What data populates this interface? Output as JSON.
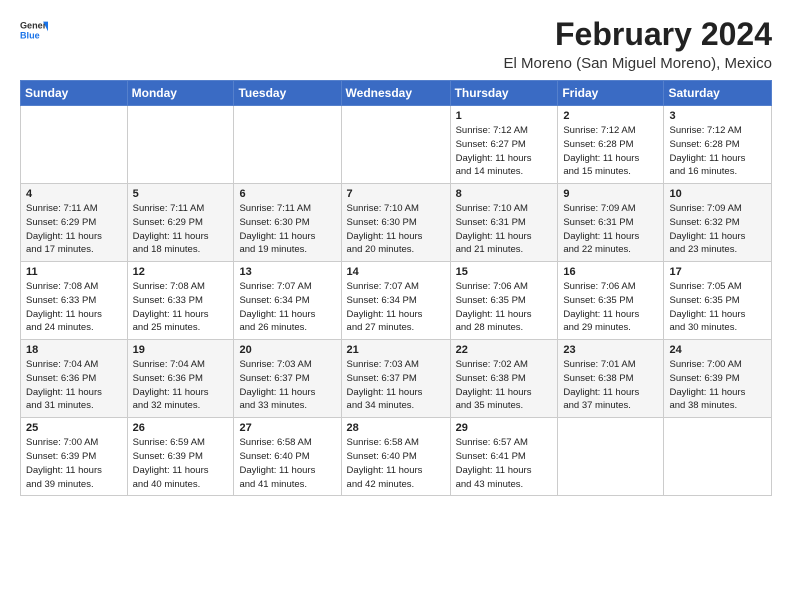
{
  "header": {
    "logo_general": "General",
    "logo_blue": "Blue",
    "title": "February 2024",
    "location": "El Moreno (San Miguel Moreno), Mexico"
  },
  "weekdays": [
    "Sunday",
    "Monday",
    "Tuesday",
    "Wednesday",
    "Thursday",
    "Friday",
    "Saturday"
  ],
  "weeks": [
    [
      {
        "day": "",
        "info": ""
      },
      {
        "day": "",
        "info": ""
      },
      {
        "day": "",
        "info": ""
      },
      {
        "day": "",
        "info": ""
      },
      {
        "day": "1",
        "info": "Sunrise: 7:12 AM\nSunset: 6:27 PM\nDaylight: 11 hours\nand 14 minutes."
      },
      {
        "day": "2",
        "info": "Sunrise: 7:12 AM\nSunset: 6:28 PM\nDaylight: 11 hours\nand 15 minutes."
      },
      {
        "day": "3",
        "info": "Sunrise: 7:12 AM\nSunset: 6:28 PM\nDaylight: 11 hours\nand 16 minutes."
      }
    ],
    [
      {
        "day": "4",
        "info": "Sunrise: 7:11 AM\nSunset: 6:29 PM\nDaylight: 11 hours\nand 17 minutes."
      },
      {
        "day": "5",
        "info": "Sunrise: 7:11 AM\nSunset: 6:29 PM\nDaylight: 11 hours\nand 18 minutes."
      },
      {
        "day": "6",
        "info": "Sunrise: 7:11 AM\nSunset: 6:30 PM\nDaylight: 11 hours\nand 19 minutes."
      },
      {
        "day": "7",
        "info": "Sunrise: 7:10 AM\nSunset: 6:30 PM\nDaylight: 11 hours\nand 20 minutes."
      },
      {
        "day": "8",
        "info": "Sunrise: 7:10 AM\nSunset: 6:31 PM\nDaylight: 11 hours\nand 21 minutes."
      },
      {
        "day": "9",
        "info": "Sunrise: 7:09 AM\nSunset: 6:31 PM\nDaylight: 11 hours\nand 22 minutes."
      },
      {
        "day": "10",
        "info": "Sunrise: 7:09 AM\nSunset: 6:32 PM\nDaylight: 11 hours\nand 23 minutes."
      }
    ],
    [
      {
        "day": "11",
        "info": "Sunrise: 7:08 AM\nSunset: 6:33 PM\nDaylight: 11 hours\nand 24 minutes."
      },
      {
        "day": "12",
        "info": "Sunrise: 7:08 AM\nSunset: 6:33 PM\nDaylight: 11 hours\nand 25 minutes."
      },
      {
        "day": "13",
        "info": "Sunrise: 7:07 AM\nSunset: 6:34 PM\nDaylight: 11 hours\nand 26 minutes."
      },
      {
        "day": "14",
        "info": "Sunrise: 7:07 AM\nSunset: 6:34 PM\nDaylight: 11 hours\nand 27 minutes."
      },
      {
        "day": "15",
        "info": "Sunrise: 7:06 AM\nSunset: 6:35 PM\nDaylight: 11 hours\nand 28 minutes."
      },
      {
        "day": "16",
        "info": "Sunrise: 7:06 AM\nSunset: 6:35 PM\nDaylight: 11 hours\nand 29 minutes."
      },
      {
        "day": "17",
        "info": "Sunrise: 7:05 AM\nSunset: 6:35 PM\nDaylight: 11 hours\nand 30 minutes."
      }
    ],
    [
      {
        "day": "18",
        "info": "Sunrise: 7:04 AM\nSunset: 6:36 PM\nDaylight: 11 hours\nand 31 minutes."
      },
      {
        "day": "19",
        "info": "Sunrise: 7:04 AM\nSunset: 6:36 PM\nDaylight: 11 hours\nand 32 minutes."
      },
      {
        "day": "20",
        "info": "Sunrise: 7:03 AM\nSunset: 6:37 PM\nDaylight: 11 hours\nand 33 minutes."
      },
      {
        "day": "21",
        "info": "Sunrise: 7:03 AM\nSunset: 6:37 PM\nDaylight: 11 hours\nand 34 minutes."
      },
      {
        "day": "22",
        "info": "Sunrise: 7:02 AM\nSunset: 6:38 PM\nDaylight: 11 hours\nand 35 minutes."
      },
      {
        "day": "23",
        "info": "Sunrise: 7:01 AM\nSunset: 6:38 PM\nDaylight: 11 hours\nand 37 minutes."
      },
      {
        "day": "24",
        "info": "Sunrise: 7:00 AM\nSunset: 6:39 PM\nDaylight: 11 hours\nand 38 minutes."
      }
    ],
    [
      {
        "day": "25",
        "info": "Sunrise: 7:00 AM\nSunset: 6:39 PM\nDaylight: 11 hours\nand 39 minutes."
      },
      {
        "day": "26",
        "info": "Sunrise: 6:59 AM\nSunset: 6:39 PM\nDaylight: 11 hours\nand 40 minutes."
      },
      {
        "day": "27",
        "info": "Sunrise: 6:58 AM\nSunset: 6:40 PM\nDaylight: 11 hours\nand 41 minutes."
      },
      {
        "day": "28",
        "info": "Sunrise: 6:58 AM\nSunset: 6:40 PM\nDaylight: 11 hours\nand 42 minutes."
      },
      {
        "day": "29",
        "info": "Sunrise: 6:57 AM\nSunset: 6:41 PM\nDaylight: 11 hours\nand 43 minutes."
      },
      {
        "day": "",
        "info": ""
      },
      {
        "day": "",
        "info": ""
      }
    ]
  ]
}
